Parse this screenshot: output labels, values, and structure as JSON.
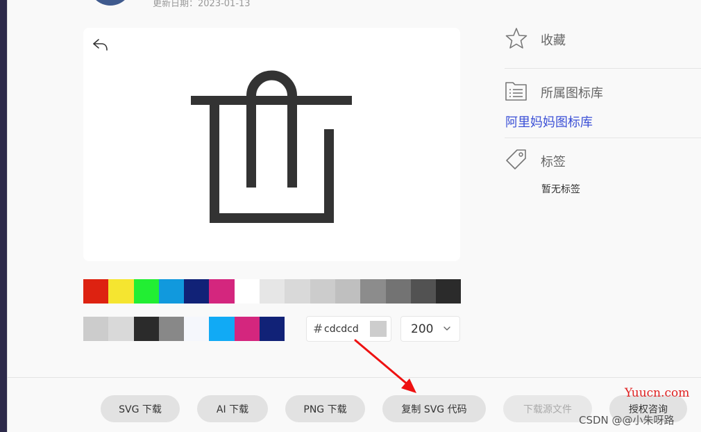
{
  "header": {
    "update_date": "更新日期：2023-01-13"
  },
  "palette": {
    "row1": [
      "#dd2211",
      "#f5e530",
      "#22ee33",
      "#1199dd",
      "#112277",
      "#d4267e",
      "#ffffff",
      "#e6e6e6",
      "#d9d9d9",
      "#cccccc",
      "#bfbfbf",
      "#8c8c8c",
      "#737373",
      "#525252",
      "#2b2b2b"
    ],
    "row2": [
      "#cccccc",
      "#d9d9d9",
      "#2b2b2b",
      "#888888",
      "#f5f7fc",
      "#11aaf5",
      "#d4267e",
      "#112277"
    ]
  },
  "color_picker": {
    "hash": "#",
    "value": "cdcdcd",
    "preview_color": "#cdcdcd"
  },
  "size_select": {
    "value": "200"
  },
  "meta": {
    "favorite_label": "收藏",
    "library_label": "所属图标库",
    "library_link": "阿里妈妈图标库",
    "tags_label": "标签",
    "no_tags": "暂无标签"
  },
  "actions": {
    "svg_download": "SVG 下载",
    "ai_download": "AI 下载",
    "png_download": "PNG 下载",
    "copy_svg": "复制 SVG 代码",
    "download_source": "下载源文件",
    "license": "授权咨询"
  },
  "watermarks": {
    "yuucn": "Yuucn.com",
    "csdn": "CSDN @@小朱呀路"
  },
  "colors": {
    "icon_stroke": "#333333",
    "link_blue": "#3a4fd6",
    "arrow_red": "#ee1111"
  },
  "icons": {
    "undo": "undo-icon",
    "trash": "trash-icon",
    "star": "star-icon",
    "library": "list-icon",
    "tag": "tag-icon",
    "chevron": "chevron-down-icon"
  }
}
